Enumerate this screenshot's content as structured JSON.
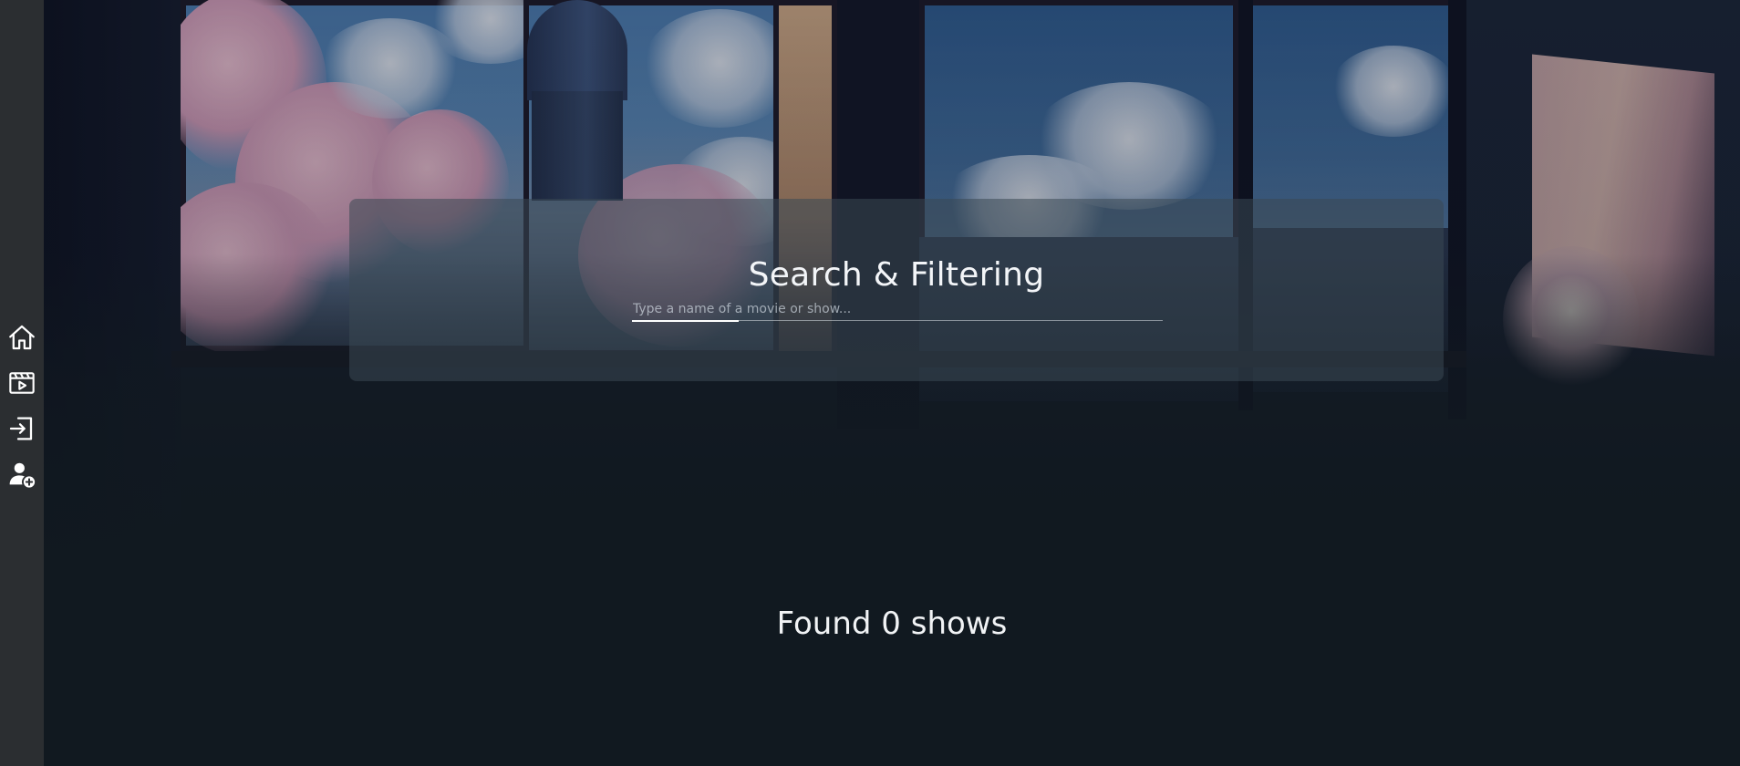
{
  "sidebar": {
    "items": [
      {
        "name": "home",
        "icon": "home-icon"
      },
      {
        "name": "shows",
        "icon": "video-icon"
      },
      {
        "name": "login",
        "icon": "login-icon"
      },
      {
        "name": "register",
        "icon": "user-add-icon"
      }
    ]
  },
  "search": {
    "title": "Search & Filtering",
    "placeholder": "Type a name of a movie or show...",
    "value": ""
  },
  "results": {
    "summary": "Found 0 shows"
  },
  "colors": {
    "sidebar_bg": "#2b2e31",
    "page_bg": "#111920",
    "panel_bg": "rgba(58,72,84,0.55)",
    "text": "#f3f5f8"
  }
}
